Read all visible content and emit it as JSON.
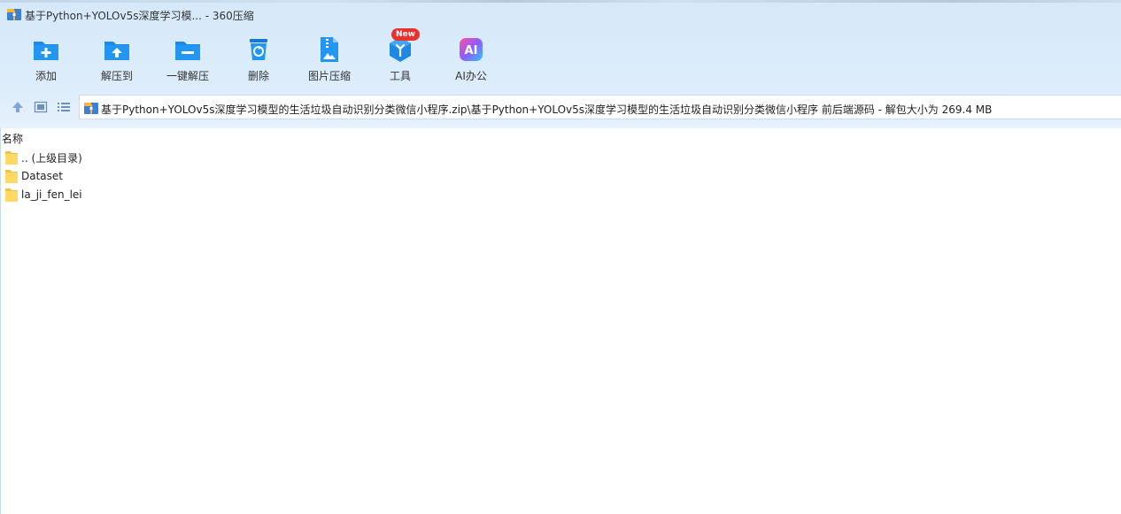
{
  "window": {
    "title": "基于Python+YOLOv5s深度学习模... - 360压缩",
    "app_icon": "archive-app-icon"
  },
  "toolbar": {
    "items": [
      {
        "label": "添加",
        "icon": "add-icon"
      },
      {
        "label": "解压到",
        "icon": "extract-to-icon"
      },
      {
        "label": "一键解压",
        "icon": "one-click-extract-icon"
      },
      {
        "label": "删除",
        "icon": "delete-icon"
      },
      {
        "label": "图片压缩",
        "icon": "image-compress-icon"
      },
      {
        "label": "工具",
        "icon": "tools-icon",
        "badge": "New"
      },
      {
        "label": "AI办公",
        "icon": "ai-office-icon",
        "icon_text": "AI"
      }
    ],
    "accent_color": "#1e88e5",
    "badge_color": "#e8322d"
  },
  "navbar": {
    "path": "基于Python+YOLOv5s深度学习模型的生活垃圾自动识别分类微信小程序.zip\\基于Python+YOLOv5s深度学习模型的生活垃圾自动识别分类微信小程序 前后端源码 - 解包大小为 269.4 MB"
  },
  "file_list": {
    "column_name": "名称",
    "rows": [
      {
        "name": ".. (上级目录)",
        "type": "folder"
      },
      {
        "name": "Dataset",
        "type": "folder"
      },
      {
        "name": "la_ji_fen_lei",
        "type": "folder"
      }
    ]
  }
}
